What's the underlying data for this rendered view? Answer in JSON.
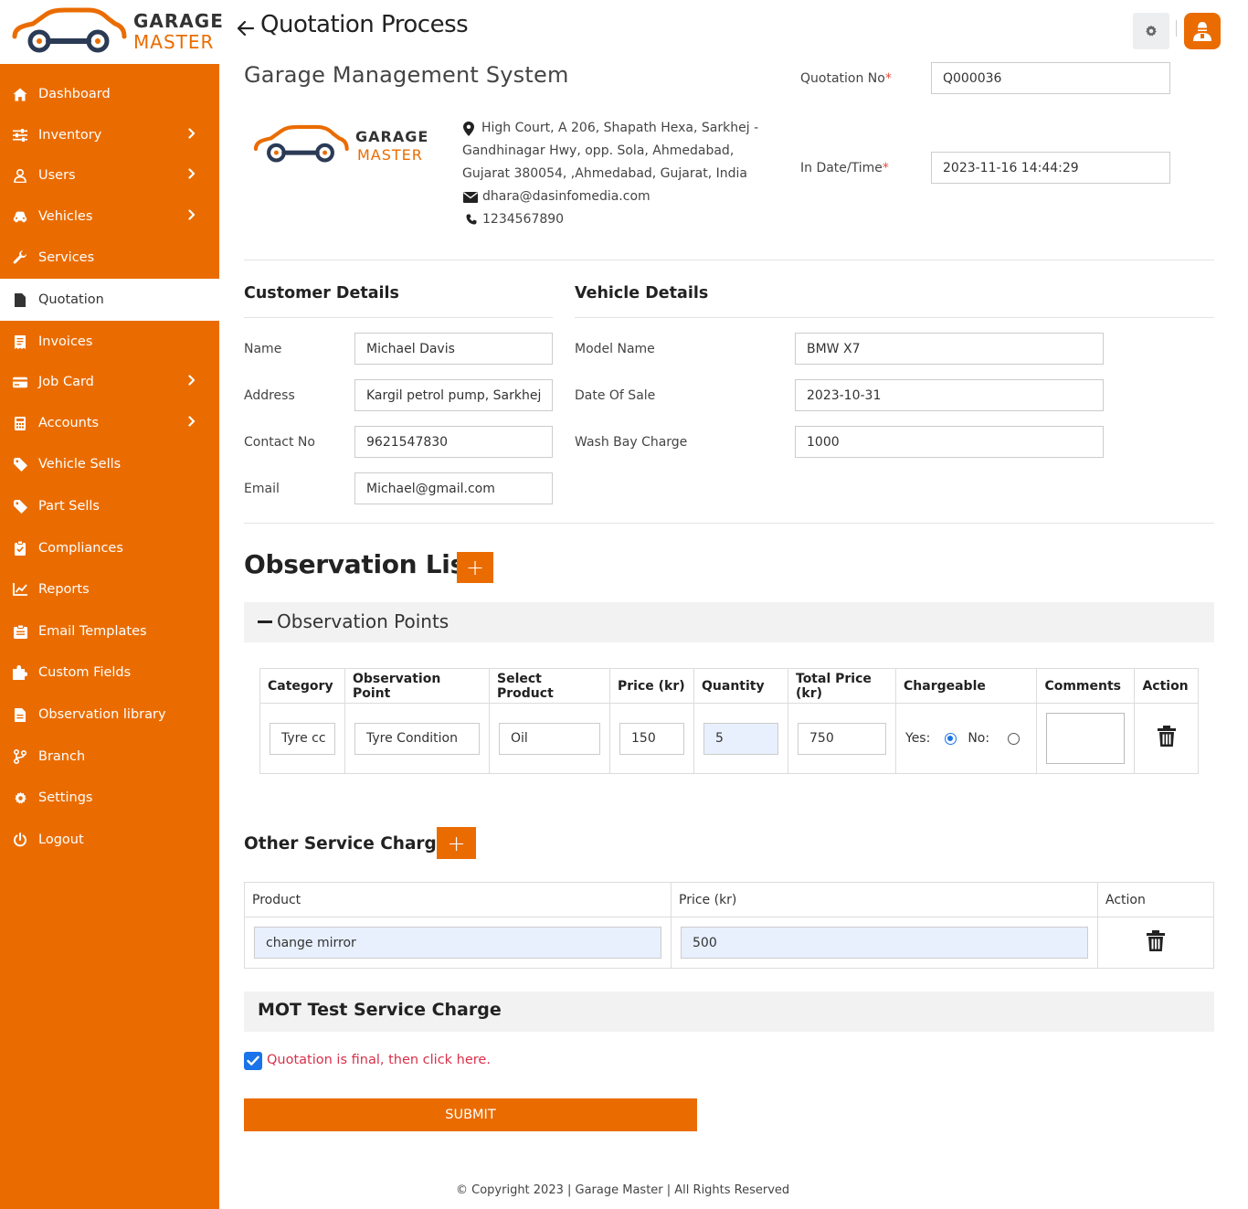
{
  "sidebar": {
    "logo": {
      "line1": "GARAGE",
      "line2": "MASTER"
    },
    "items": [
      {
        "label": "Dashboard",
        "icon": "home-icon",
        "chevron": false
      },
      {
        "label": "Inventory",
        "icon": "sliders-icon",
        "chevron": true
      },
      {
        "label": "Users",
        "icon": "user-icon",
        "chevron": true
      },
      {
        "label": "Vehicles",
        "icon": "car-icon",
        "chevron": true
      },
      {
        "label": "Services",
        "icon": "wrench-icon",
        "chevron": false
      },
      {
        "label": "Quotation",
        "icon": "file-invoice-icon",
        "chevron": false,
        "active": true
      },
      {
        "label": "Invoices",
        "icon": "receipt-icon",
        "chevron": false
      },
      {
        "label": "Job Card",
        "icon": "card-icon",
        "chevron": true
      },
      {
        "label": "Accounts",
        "icon": "calculator-icon",
        "chevron": true
      },
      {
        "label": "Vehicle Sells",
        "icon": "tag-icon",
        "chevron": false
      },
      {
        "label": "Part Sells",
        "icon": "tag-icon",
        "chevron": false
      },
      {
        "label": "Compliances",
        "icon": "clipboard-check-icon",
        "chevron": false
      },
      {
        "label": "Reports",
        "icon": "chart-line-icon",
        "chevron": false
      },
      {
        "label": "Email Templates",
        "icon": "envelope-form-icon",
        "chevron": false
      },
      {
        "label": "Custom Fields",
        "icon": "puzzle-icon",
        "chevron": false
      },
      {
        "label": "Observation library",
        "icon": "file-icon",
        "chevron": false
      },
      {
        "label": "Branch",
        "icon": "branch-icon",
        "chevron": false
      },
      {
        "label": "Settings",
        "icon": "gear-icon",
        "chevron": false
      },
      {
        "label": "Logout",
        "icon": "power-icon",
        "chevron": false
      }
    ]
  },
  "header": {
    "title": "Quotation Process"
  },
  "company": {
    "name": "Garage Management System",
    "logo_line1": "GARAGE",
    "logo_line2": "MASTER",
    "address_line1": "High Court, A 206, Shapath Hexa, Sarkhej -",
    "address_line2": "Gandhinagar Hwy, opp. Sola, Ahmedabad,",
    "address_line3": "Gujarat 380054, ,Ahmedabad, Gujarat, India",
    "email": "dhara@dasinfomedia.com",
    "phone": "1234567890"
  },
  "quotation": {
    "number_label": "Quotation No",
    "number_value": "Q000036",
    "date_label": "In Date/Time",
    "date_value": "2023-11-16 14:44:29",
    "required_mark": "*"
  },
  "customer": {
    "title": "Customer Details",
    "name_label": "Name",
    "name_value": "Michael Davis",
    "address_label": "Address",
    "address_value": "Kargil petrol pump, Sarkhej",
    "contact_label": "Contact No",
    "contact_value": "9621547830",
    "email_label": "Email",
    "email_value": "Michael@gmail.com"
  },
  "vehicle": {
    "title": "Vehicle Details",
    "model_label": "Model Name",
    "model_value": "BMW X7",
    "sale_label": "Date Of Sale",
    "sale_value": "2023-10-31",
    "wash_label": "Wash Bay Charge",
    "wash_value": "1000"
  },
  "observation": {
    "title": "Observation List",
    "add_label": "+",
    "points_title": "Observation Points",
    "columns": [
      "Category",
      "Observation Point",
      "Select Product",
      "Price (kr)",
      "Quantity",
      "Total Price (kr)",
      "Chargeable",
      "Comments",
      "Action"
    ],
    "row": {
      "category": "Tyre cc",
      "point": "Tyre Condition",
      "product": "Oil",
      "price": "150",
      "quantity": "5",
      "total": "750",
      "yes_label": "Yes:",
      "no_label": "No:",
      "chargeable": "yes",
      "comments": ""
    }
  },
  "other_charges": {
    "title": "Other Service Charges",
    "add_label": "+",
    "columns": [
      "Product",
      "Price (kr)",
      "Action"
    ],
    "row": {
      "product": "change mirror",
      "price": "500"
    }
  },
  "mot": {
    "title": "MOT Test Service Charge",
    "final_label": "Quotation is final, then click here.",
    "final_checked": true
  },
  "submit_label": "SUBMIT",
  "footer": "© Copyright 2023 | Garage Master | All Rights Reserved",
  "colors": {
    "accent": "#ea6c00",
    "checkbox": "#1a73e8",
    "warning_text": "#d9304a"
  }
}
